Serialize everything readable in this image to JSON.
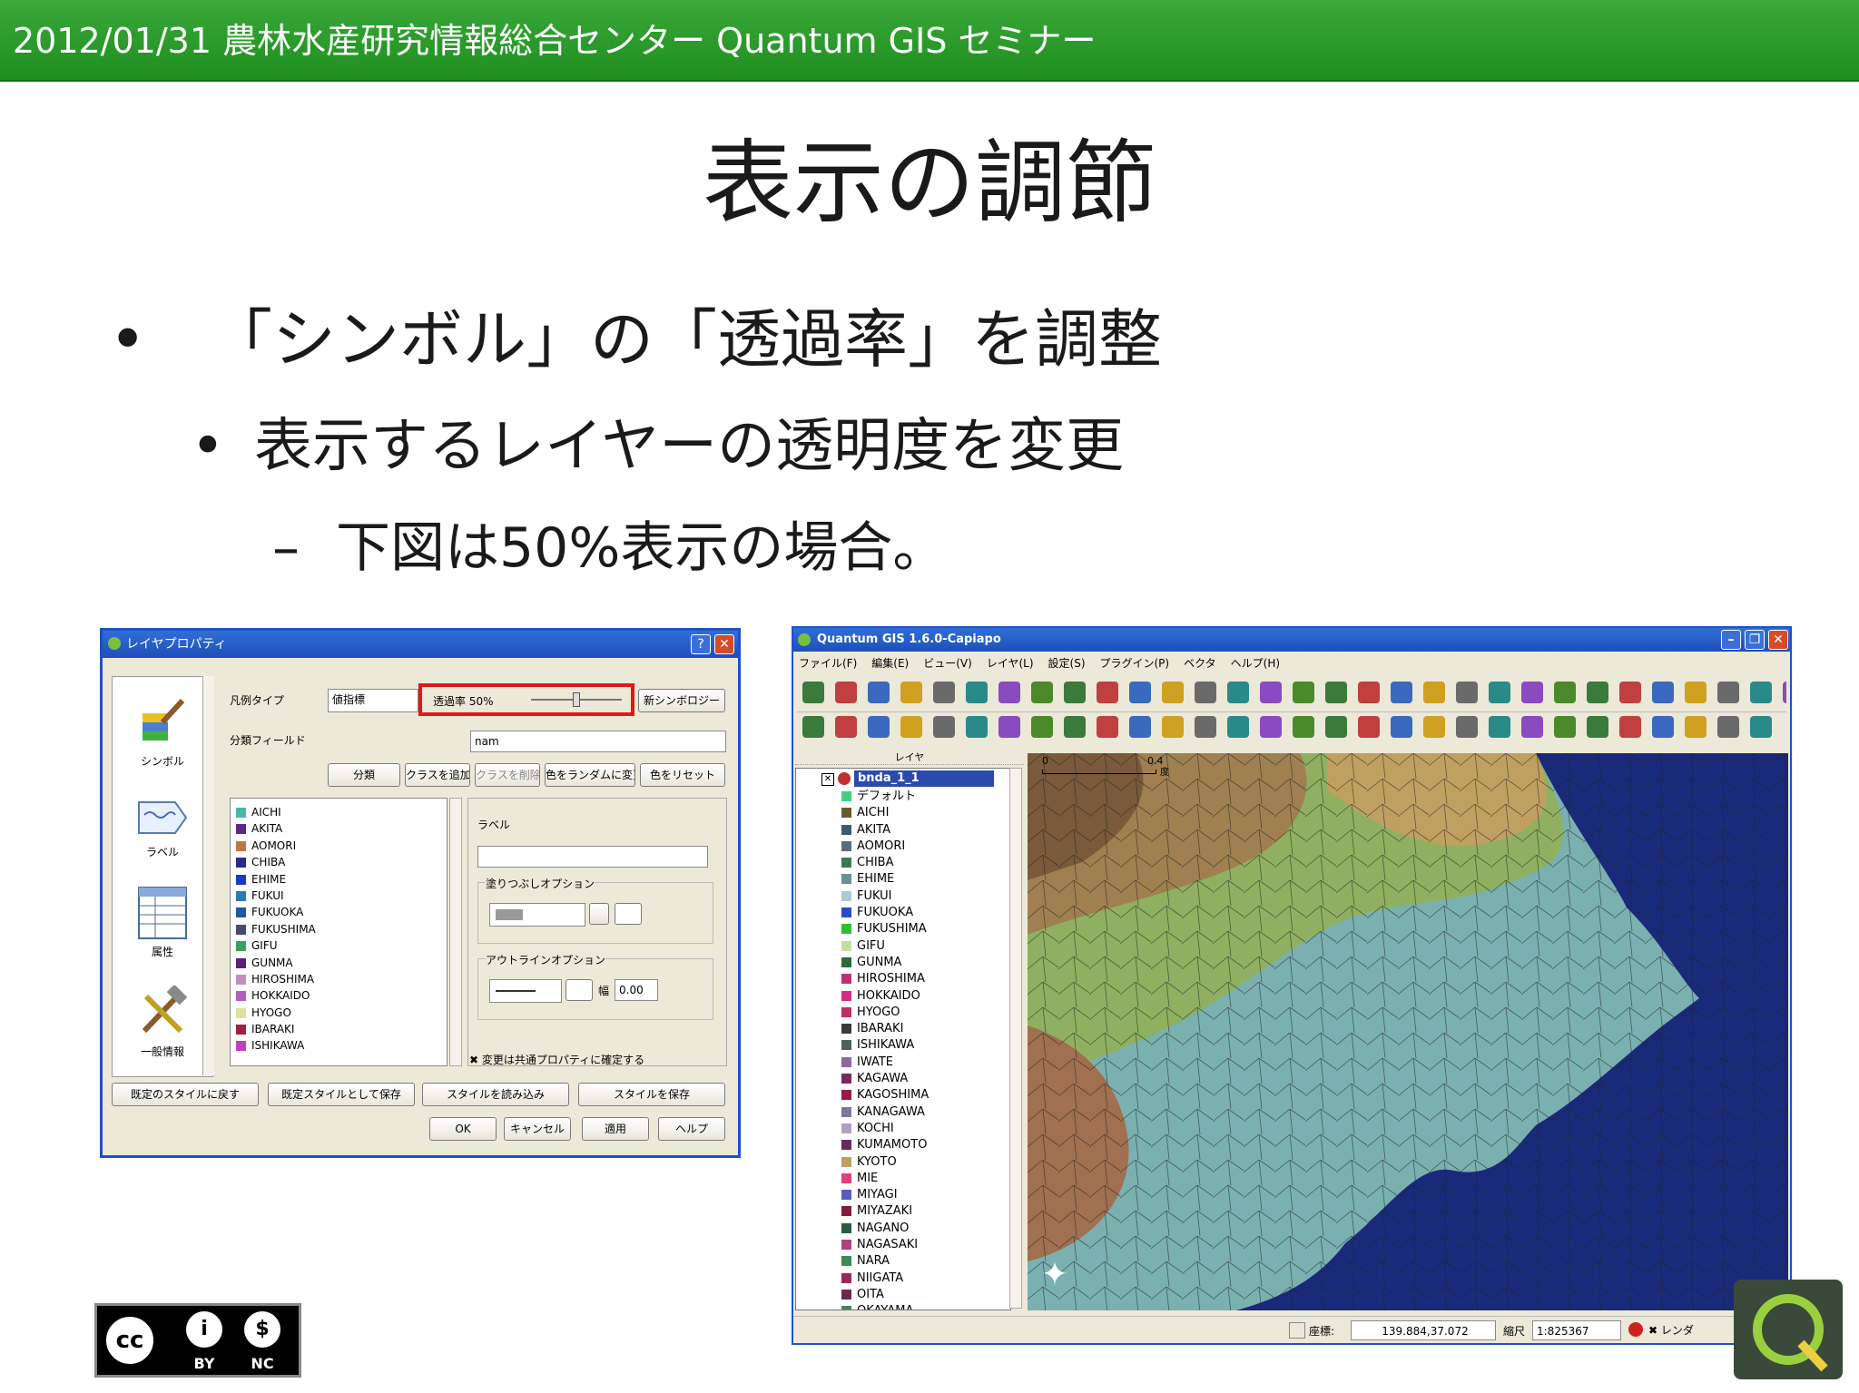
{
  "header": {
    "text": "2012/01/31 農林水産研究情報総合センター Quantum GIS セミナー"
  },
  "slide": {
    "title": "表示の調節",
    "bullet1": "「シンボル」の「透過率」を調整",
    "bullet2": "表示するレイヤーの透明度を変更",
    "bullet3": "下図は50%表示の場合。",
    "dash": "–"
  },
  "dialog": {
    "title": "レイヤプロパティ",
    "sidebar": [
      "シンボル",
      "ラベル",
      "属性",
      "一般情報"
    ],
    "legend_type_label": "凡例タイプ",
    "legend_type_value": "値指標",
    "transparency_label": "透過率 50%",
    "transparency_percent": 50,
    "new_symbology": "新シンボロジー",
    "class_field_label": "分類フィールド",
    "class_field_value": "nam",
    "buttons_row": [
      "分類",
      "クラスを追加",
      "クラスを削除",
      "色をランダムに変更",
      "色をリセット"
    ],
    "classes": [
      {
        "name": "AICHI",
        "color": "#4ab8a8"
      },
      {
        "name": "AKITA",
        "color": "#5a2a8a"
      },
      {
        "name": "AOMORI",
        "color": "#c07840"
      },
      {
        "name": "CHIBA",
        "color": "#2a2a8a"
      },
      {
        "name": "EHIME",
        "color": "#1a3ac8"
      },
      {
        "name": "FUKUI",
        "color": "#2a7ab0"
      },
      {
        "name": "FUKUOKA",
        "color": "#205aa0"
      },
      {
        "name": "FUKUSHIMA",
        "color": "#4a4a70"
      },
      {
        "name": "GIFU",
        "color": "#3aa060"
      },
      {
        "name": "GUNMA",
        "color": "#5a2080"
      },
      {
        "name": "HIROSHIMA",
        "color": "#c090c0"
      },
      {
        "name": "HOKKAIDO",
        "color": "#b060c0"
      },
      {
        "name": "HYOGO",
        "color": "#e0e0a0"
      },
      {
        "name": "IBARAKI",
        "color": "#a02040"
      },
      {
        "name": "ISHIKAWA",
        "color": "#c040c0"
      }
    ],
    "label_label": "ラベル",
    "fill_options": "塗りつぶしオプション",
    "outline_options": "アウトラインオプション",
    "width_label": "幅",
    "width_value": "0.00",
    "apply_all": "変更は共通プロパティに確定する",
    "bottom_buttons": [
      "既定のスタイルに戻す",
      "既定スタイルとして保存",
      "スタイルを読み込み",
      "スタイルを保存"
    ],
    "ok": "OK",
    "cancel": "キャンセル",
    "apply": "適用",
    "help": "ヘルプ"
  },
  "qgis": {
    "title": "Quantum GIS 1.6.0-Capiapo",
    "menu": [
      "ファイル(F)",
      "編集(E)",
      "ビュー(V)",
      "レイヤ(L)",
      "設定(S)",
      "プラグイン(P)",
      "ベクタ",
      "ヘルプ(H)"
    ],
    "layer_panel_title": "レイヤ",
    "layer_name": "bnda_1_1",
    "default_item": "デフォルト",
    "layers": [
      {
        "name": "AICHI",
        "color": "#6a5a30"
      },
      {
        "name": "AKITA",
        "color": "#3a5a70"
      },
      {
        "name": "AOMORI",
        "color": "#5a6a80"
      },
      {
        "name": "CHIBA",
        "color": "#3a7a50"
      },
      {
        "name": "EHIME",
        "color": "#6a9090"
      },
      {
        "name": "FUKUI",
        "color": "#b0c8d8"
      },
      {
        "name": "FUKUOKA",
        "color": "#2a4ac8"
      },
      {
        "name": "FUKUSHIMA",
        "color": "#30c030"
      },
      {
        "name": "GIFU",
        "color": "#c0e0a0"
      },
      {
        "name": "GUNMA",
        "color": "#2a6a3a"
      },
      {
        "name": "HIROSHIMA",
        "color": "#c03070"
      },
      {
        "name": "HOKKAIDO",
        "color": "#d03080"
      },
      {
        "name": "HYOGO",
        "color": "#c03060"
      },
      {
        "name": "IBARAKI",
        "color": "#3a3a3a"
      },
      {
        "name": "ISHIKAWA",
        "color": "#506060"
      },
      {
        "name": "IWATE",
        "color": "#8a6aa0"
      },
      {
        "name": "KAGAWA",
        "color": "#7a2a5a"
      },
      {
        "name": "KAGOSHIMA",
        "color": "#9a1a4a"
      },
      {
        "name": "KANAGAWA",
        "color": "#7a7aa0"
      },
      {
        "name": "KOCHI",
        "color": "#b0a0c0"
      },
      {
        "name": "KUMAMOTO",
        "color": "#6a2a5a"
      },
      {
        "name": "KYOTO",
        "color": "#c0a060"
      },
      {
        "name": "MIE",
        "color": "#e04080"
      },
      {
        "name": "MIYAGI",
        "color": "#5a5ac0"
      },
      {
        "name": "MIYAZAKI",
        "color": "#8a1a3a"
      },
      {
        "name": "NAGANO",
        "color": "#2a5a40"
      },
      {
        "name": "NAGASAKI",
        "color": "#b04080"
      },
      {
        "name": "NARA",
        "color": "#3a8a5a"
      },
      {
        "name": "NIIGATA",
        "color": "#9a2a5a"
      },
      {
        "name": "OITA",
        "color": "#6a2a4a"
      },
      {
        "name": "OKAYAMA",
        "color": "#4a8060"
      }
    ],
    "scalebar_zero": "0",
    "scalebar_value": "0.4",
    "scalebar_unit": "度",
    "status": {
      "coord_label": "座標:",
      "coord_value": "139.884,37.072",
      "scale_label": "縮尺",
      "scale_value": "1:825367",
      "render_label": "レンダ"
    },
    "colors": {
      "sea": "#1a2a7a",
      "north": "#a08050",
      "plain": "#7ab0b0"
    }
  },
  "license": {
    "cc": "cc",
    "by": "BY",
    "nc": "NC"
  }
}
